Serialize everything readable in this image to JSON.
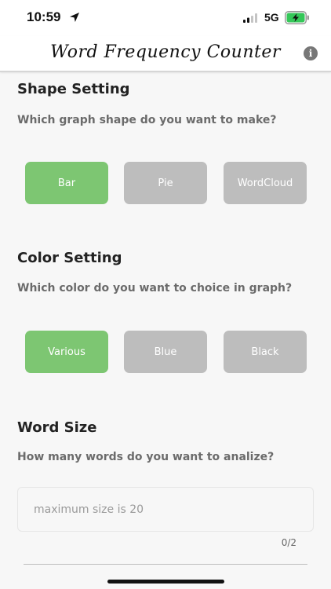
{
  "status_bar": {
    "time": "10:59",
    "network": "5G",
    "icons": [
      "location-arrow-icon",
      "signal-icon",
      "battery-charging-icon"
    ],
    "battery_color": "#35c759"
  },
  "nav": {
    "title": "Word Frequency Counter",
    "info_icon": "info-icon"
  },
  "shape_setting": {
    "title": "Shape Setting",
    "question": "Which graph shape do you want to make?",
    "options": [
      "Bar",
      "Pie",
      "WordCloud"
    ],
    "selected": "Bar"
  },
  "color_setting": {
    "title": "Color Setting",
    "question": "Which color do you want to choice in graph?",
    "options": [
      "Various",
      "Blue",
      "Black"
    ],
    "selected": "Various"
  },
  "word_size": {
    "title": "Word Size",
    "question": "How many words do you want to analize?",
    "input_value": "",
    "placeholder": "maximum size is 20",
    "counter": "0/2"
  },
  "colors": {
    "selected": "#7dc672",
    "unselected": "#bdbdbd"
  }
}
